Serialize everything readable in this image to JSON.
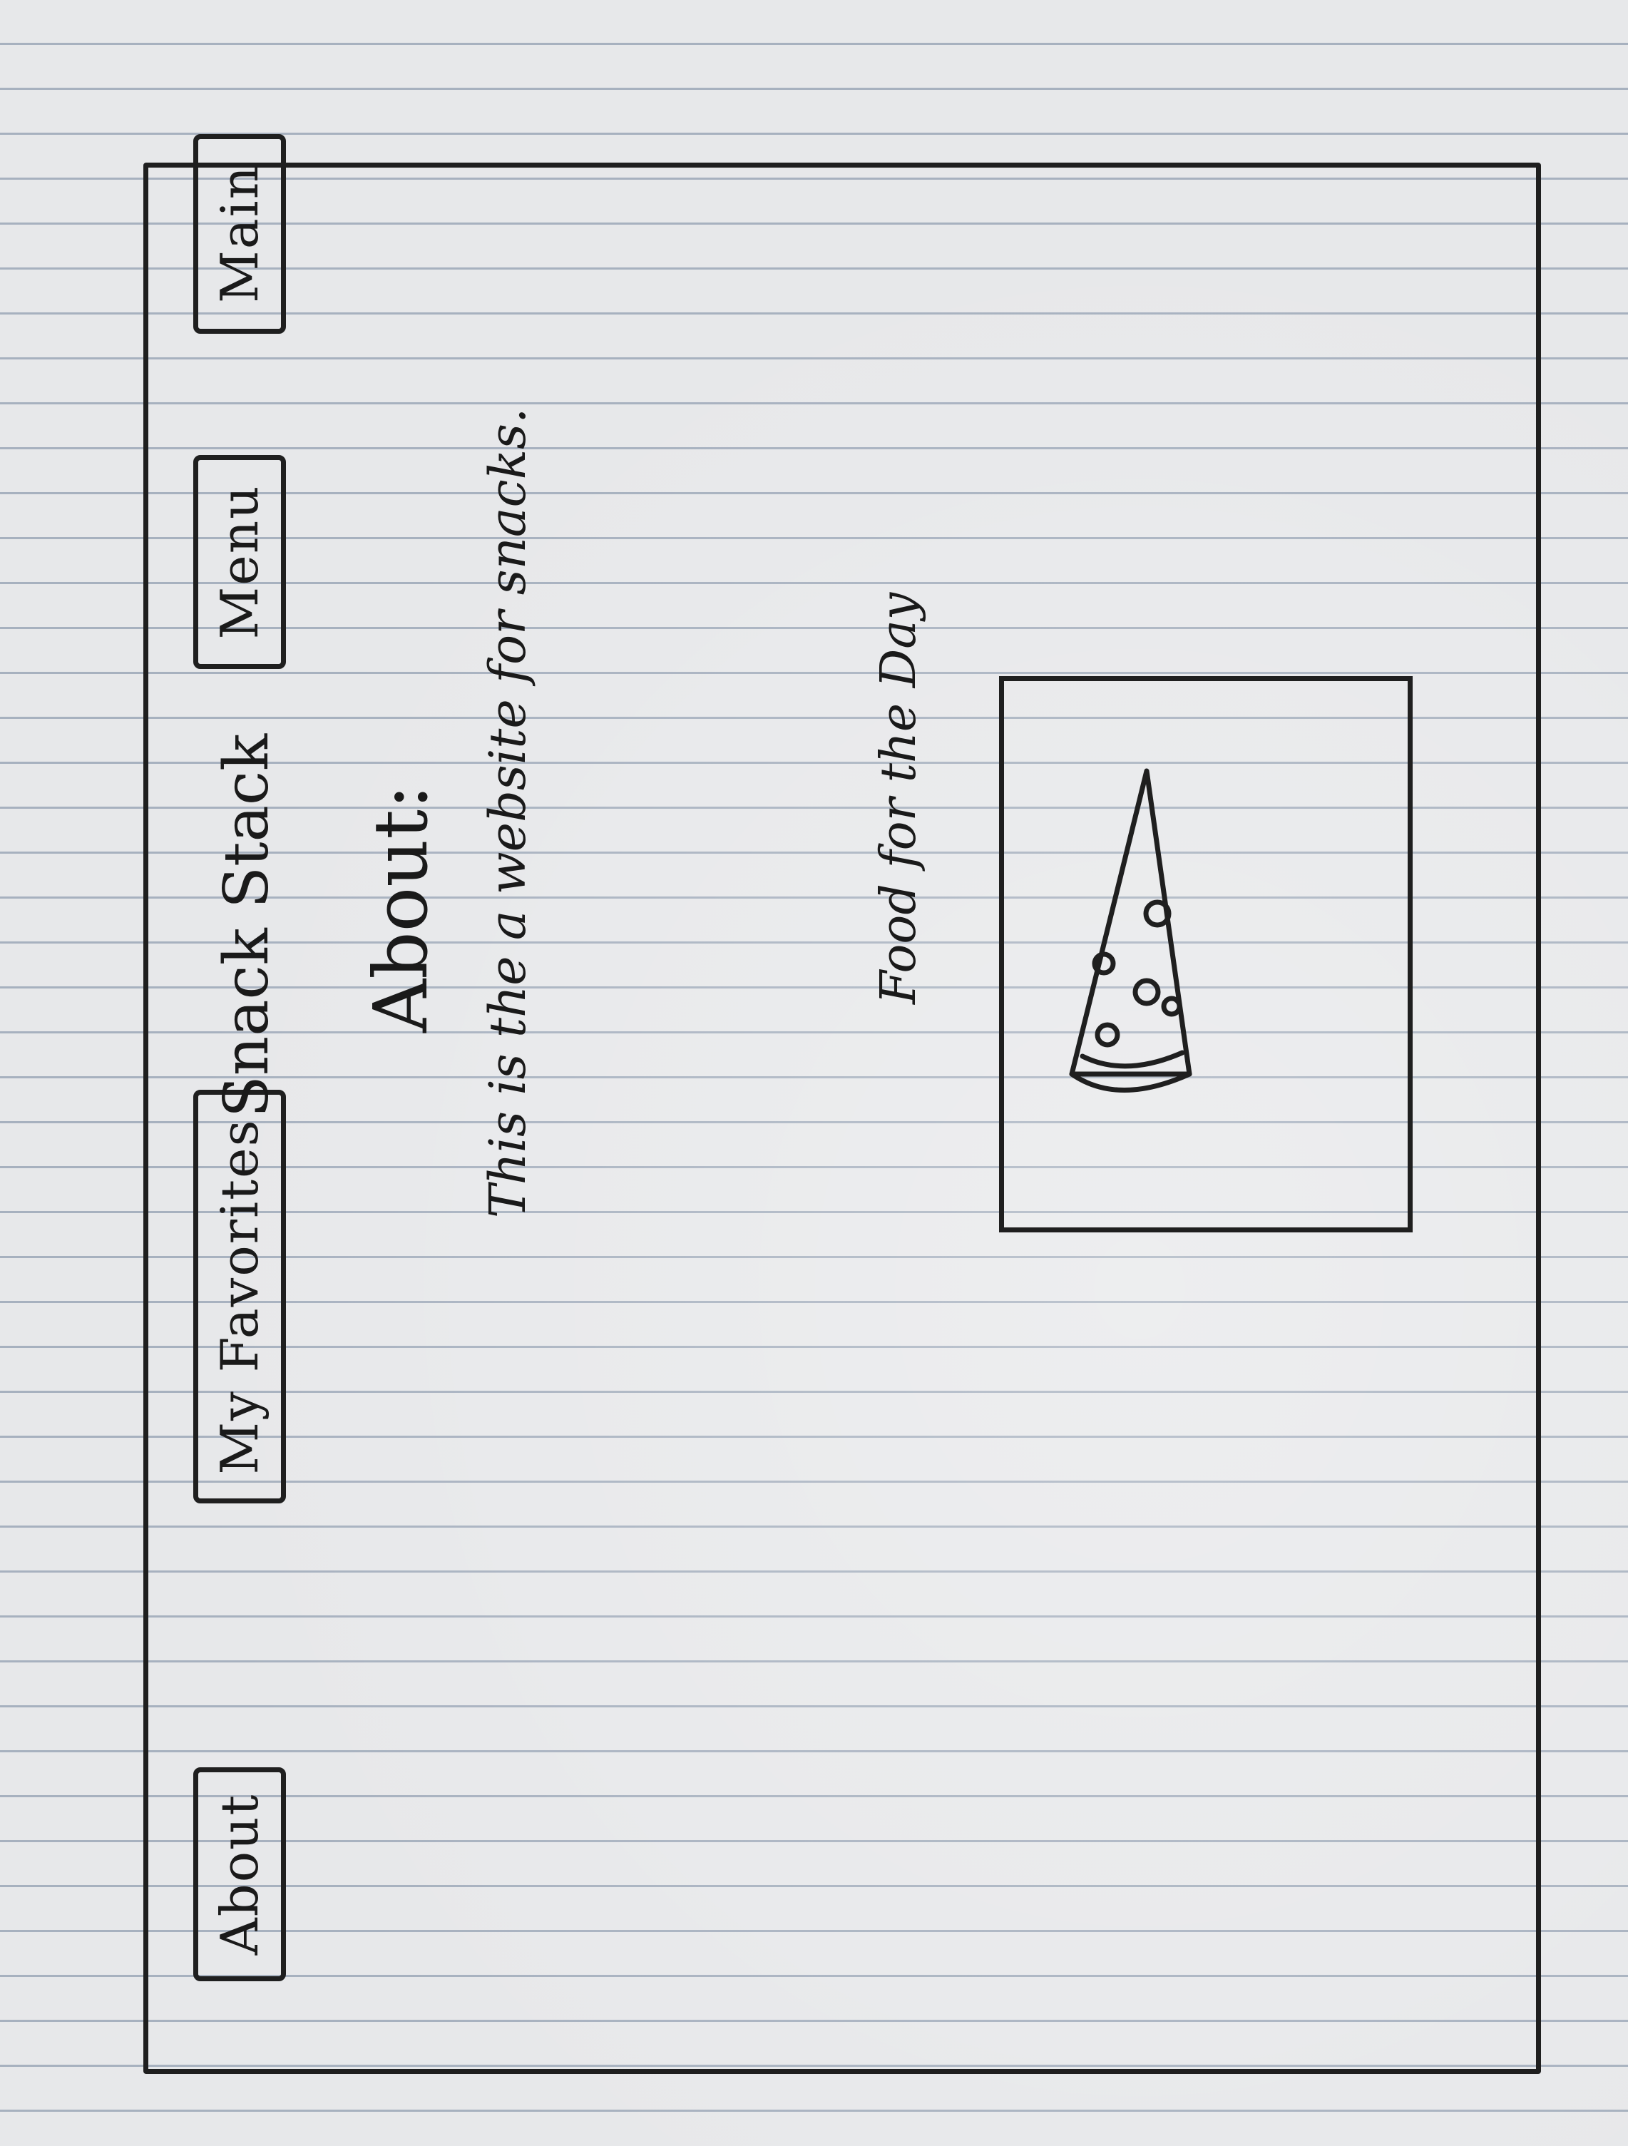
{
  "nav": {
    "about_label": "About",
    "favorites_label": "My Favorites",
    "menu_label": "Menu",
    "main_label": "Main"
  },
  "header": {
    "site_title": "Snack Stack"
  },
  "about": {
    "heading": "About:",
    "text": "This is the a website for snacks."
  },
  "food_of_the_day": {
    "title": "Food for the Day",
    "image_icon": "pizza-slice-icon"
  }
}
